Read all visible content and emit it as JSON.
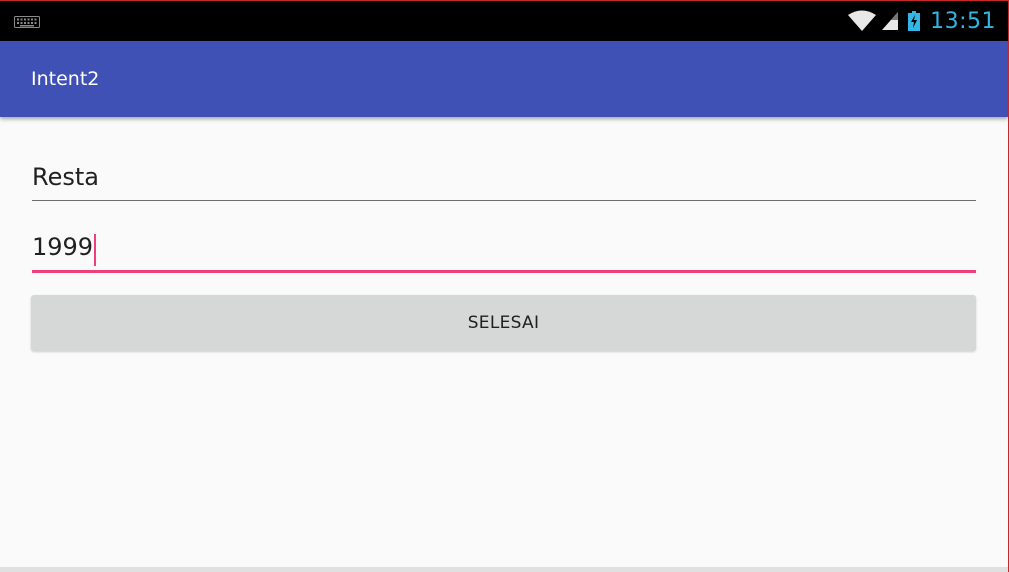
{
  "status_bar": {
    "time": "13:51",
    "icons": [
      "keyboard-icon",
      "wifi-icon",
      "cell-signal-icon",
      "battery-charging-icon"
    ],
    "time_color": "#33b5e5"
  },
  "app_bar": {
    "title": "Intent2",
    "color": "#3f51b5"
  },
  "form": {
    "name_value": "Resta",
    "year_value": "1999",
    "focused_field_color": "#ec407a",
    "submit_label": "SELESAI"
  }
}
